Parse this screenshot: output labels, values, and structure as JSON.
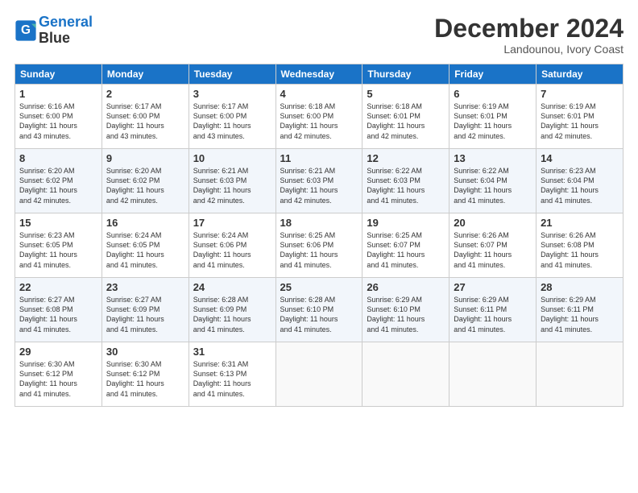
{
  "header": {
    "logo_line1": "General",
    "logo_line2": "Blue",
    "month": "December 2024",
    "location": "Landounou, Ivory Coast"
  },
  "weekdays": [
    "Sunday",
    "Monday",
    "Tuesday",
    "Wednesday",
    "Thursday",
    "Friday",
    "Saturday"
  ],
  "weeks": [
    [
      {
        "day": "1",
        "info": "Sunrise: 6:16 AM\nSunset: 6:00 PM\nDaylight: 11 hours\nand 43 minutes."
      },
      {
        "day": "2",
        "info": "Sunrise: 6:17 AM\nSunset: 6:00 PM\nDaylight: 11 hours\nand 43 minutes."
      },
      {
        "day": "3",
        "info": "Sunrise: 6:17 AM\nSunset: 6:00 PM\nDaylight: 11 hours\nand 43 minutes."
      },
      {
        "day": "4",
        "info": "Sunrise: 6:18 AM\nSunset: 6:00 PM\nDaylight: 11 hours\nand 42 minutes."
      },
      {
        "day": "5",
        "info": "Sunrise: 6:18 AM\nSunset: 6:01 PM\nDaylight: 11 hours\nand 42 minutes."
      },
      {
        "day": "6",
        "info": "Sunrise: 6:19 AM\nSunset: 6:01 PM\nDaylight: 11 hours\nand 42 minutes."
      },
      {
        "day": "7",
        "info": "Sunrise: 6:19 AM\nSunset: 6:01 PM\nDaylight: 11 hours\nand 42 minutes."
      }
    ],
    [
      {
        "day": "8",
        "info": "Sunrise: 6:20 AM\nSunset: 6:02 PM\nDaylight: 11 hours\nand 42 minutes."
      },
      {
        "day": "9",
        "info": "Sunrise: 6:20 AM\nSunset: 6:02 PM\nDaylight: 11 hours\nand 42 minutes."
      },
      {
        "day": "10",
        "info": "Sunrise: 6:21 AM\nSunset: 6:03 PM\nDaylight: 11 hours\nand 42 minutes."
      },
      {
        "day": "11",
        "info": "Sunrise: 6:21 AM\nSunset: 6:03 PM\nDaylight: 11 hours\nand 42 minutes."
      },
      {
        "day": "12",
        "info": "Sunrise: 6:22 AM\nSunset: 6:03 PM\nDaylight: 11 hours\nand 41 minutes."
      },
      {
        "day": "13",
        "info": "Sunrise: 6:22 AM\nSunset: 6:04 PM\nDaylight: 11 hours\nand 41 minutes."
      },
      {
        "day": "14",
        "info": "Sunrise: 6:23 AM\nSunset: 6:04 PM\nDaylight: 11 hours\nand 41 minutes."
      }
    ],
    [
      {
        "day": "15",
        "info": "Sunrise: 6:23 AM\nSunset: 6:05 PM\nDaylight: 11 hours\nand 41 minutes."
      },
      {
        "day": "16",
        "info": "Sunrise: 6:24 AM\nSunset: 6:05 PM\nDaylight: 11 hours\nand 41 minutes."
      },
      {
        "day": "17",
        "info": "Sunrise: 6:24 AM\nSunset: 6:06 PM\nDaylight: 11 hours\nand 41 minutes."
      },
      {
        "day": "18",
        "info": "Sunrise: 6:25 AM\nSunset: 6:06 PM\nDaylight: 11 hours\nand 41 minutes."
      },
      {
        "day": "19",
        "info": "Sunrise: 6:25 AM\nSunset: 6:07 PM\nDaylight: 11 hours\nand 41 minutes."
      },
      {
        "day": "20",
        "info": "Sunrise: 6:26 AM\nSunset: 6:07 PM\nDaylight: 11 hours\nand 41 minutes."
      },
      {
        "day": "21",
        "info": "Sunrise: 6:26 AM\nSunset: 6:08 PM\nDaylight: 11 hours\nand 41 minutes."
      }
    ],
    [
      {
        "day": "22",
        "info": "Sunrise: 6:27 AM\nSunset: 6:08 PM\nDaylight: 11 hours\nand 41 minutes."
      },
      {
        "day": "23",
        "info": "Sunrise: 6:27 AM\nSunset: 6:09 PM\nDaylight: 11 hours\nand 41 minutes."
      },
      {
        "day": "24",
        "info": "Sunrise: 6:28 AM\nSunset: 6:09 PM\nDaylight: 11 hours\nand 41 minutes."
      },
      {
        "day": "25",
        "info": "Sunrise: 6:28 AM\nSunset: 6:10 PM\nDaylight: 11 hours\nand 41 minutes."
      },
      {
        "day": "26",
        "info": "Sunrise: 6:29 AM\nSunset: 6:10 PM\nDaylight: 11 hours\nand 41 minutes."
      },
      {
        "day": "27",
        "info": "Sunrise: 6:29 AM\nSunset: 6:11 PM\nDaylight: 11 hours\nand 41 minutes."
      },
      {
        "day": "28",
        "info": "Sunrise: 6:29 AM\nSunset: 6:11 PM\nDaylight: 11 hours\nand 41 minutes."
      }
    ],
    [
      {
        "day": "29",
        "info": "Sunrise: 6:30 AM\nSunset: 6:12 PM\nDaylight: 11 hours\nand 41 minutes."
      },
      {
        "day": "30",
        "info": "Sunrise: 6:30 AM\nSunset: 6:12 PM\nDaylight: 11 hours\nand 41 minutes."
      },
      {
        "day": "31",
        "info": "Sunrise: 6:31 AM\nSunset: 6:13 PM\nDaylight: 11 hours\nand 41 minutes."
      },
      {
        "day": "",
        "info": ""
      },
      {
        "day": "",
        "info": ""
      },
      {
        "day": "",
        "info": ""
      },
      {
        "day": "",
        "info": ""
      }
    ]
  ]
}
